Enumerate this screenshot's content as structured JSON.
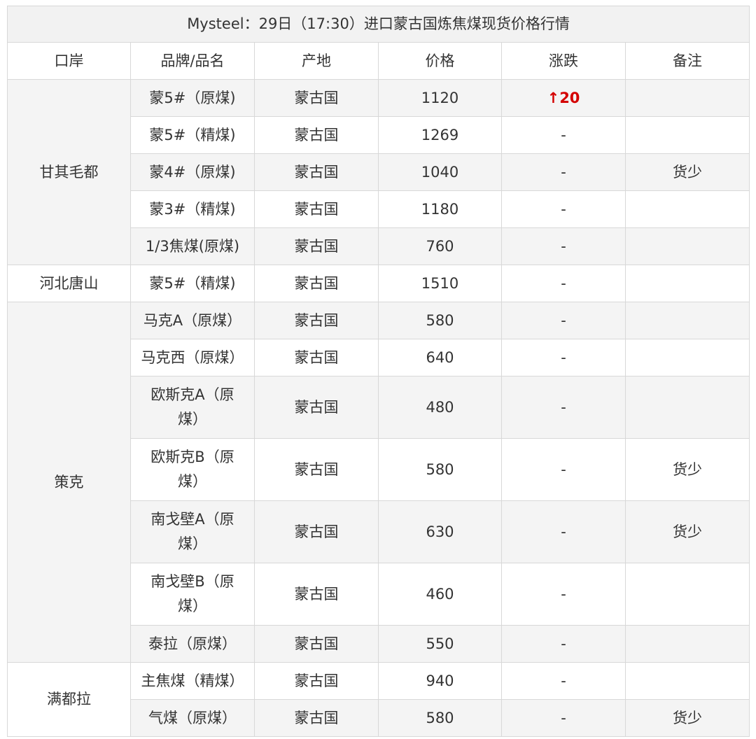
{
  "title": "Mysteel：29日（17:30）进口蒙古国炼焦煤现货价格行情",
  "headers": {
    "port": "口岸",
    "brand": "品牌/品名",
    "origin": "产地",
    "price": "价格",
    "change": "涨跌",
    "remark": "备注"
  },
  "ports": [
    "甘其毛都",
    "河北唐山",
    "策克",
    "满都拉"
  ],
  "rows": [
    {
      "brand": "蒙5#（原煤)",
      "origin": "蒙古国",
      "price": "1120",
      "change": "20",
      "change_arrow": "↑",
      "remark": ""
    },
    {
      "brand": "蒙5#（精煤)",
      "origin": "蒙古国",
      "price": "1269",
      "change": "-",
      "remark": ""
    },
    {
      "brand": "蒙4#（原煤)",
      "origin": "蒙古国",
      "price": "1040",
      "change": "-",
      "remark": "货少"
    },
    {
      "brand": "蒙3#（精煤)",
      "origin": "蒙古国",
      "price": "1180",
      "change": "-",
      "remark": ""
    },
    {
      "brand": "1/3焦煤(原煤)",
      "origin": "蒙古国",
      "price": "760",
      "change": "-",
      "remark": ""
    },
    {
      "brand": "蒙5#（精煤)",
      "origin": "蒙古国",
      "price": "1510",
      "change": "-",
      "remark": ""
    },
    {
      "brand": "马克A（原煤）",
      "origin": "蒙古国",
      "price": "580",
      "change": "-",
      "remark": ""
    },
    {
      "brand": "马克西（原煤）",
      "origin": "蒙古国",
      "price": "640",
      "change": "-",
      "remark": ""
    },
    {
      "brand": "欧斯克A（原煤）",
      "origin": "蒙古国",
      "price": "480",
      "change": "-",
      "remark": ""
    },
    {
      "brand": "欧斯克B（原煤）",
      "origin": "蒙古国",
      "price": "580",
      "change": "-",
      "remark": "货少"
    },
    {
      "brand": "南戈壁A（原煤）",
      "origin": "蒙古国",
      "price": "630",
      "change": "-",
      "remark": "货少"
    },
    {
      "brand": "南戈壁B（原煤）",
      "origin": "蒙古国",
      "price": "460",
      "change": "-",
      "remark": ""
    },
    {
      "brand": "泰拉（原煤）",
      "origin": "蒙古国",
      "price": "550",
      "change": "-",
      "remark": ""
    },
    {
      "brand": "主焦煤（精煤）",
      "origin": "蒙古国",
      "price": "940",
      "change": "-",
      "remark": ""
    },
    {
      "brand": "气煤（原煤）",
      "origin": "蒙古国",
      "price": "580",
      "change": "-",
      "remark": "货少"
    }
  ],
  "colors": {
    "border": "#d8d8d8",
    "title_bg": "#f2f2f2",
    "stripe_bg": "#f4f4f4",
    "up_red": "#d40000",
    "text": "#333333"
  }
}
